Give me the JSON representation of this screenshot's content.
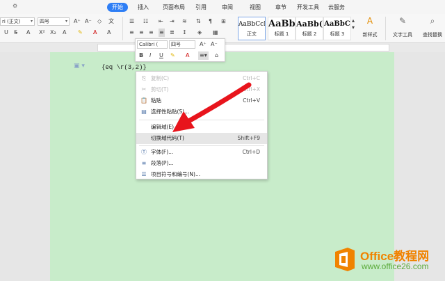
{
  "menu": {
    "tabs": [
      "开始",
      "插入",
      "页面布局",
      "引用",
      "审阅",
      "视图",
      "章节",
      "开发工具",
      "云服务"
    ],
    "active_index": 0
  },
  "ribbon": {
    "font_name": "ri (正文)",
    "font_size": "四号",
    "grow_font": "A⁺",
    "shrink_font": "A⁻",
    "font_color_label": "A",
    "styles": [
      {
        "sample": "AaBbCcI",
        "caption": "正文"
      },
      {
        "sample": "AaBb",
        "caption": "标题 1"
      },
      {
        "sample": "AaBb(",
        "caption": "标题 2"
      },
      {
        "sample": "AaBbC",
        "caption": "标题 3"
      }
    ],
    "new_style": "新样式",
    "text_tools": "文字工具",
    "find_replace": "查找替换"
  },
  "mini_toolbar": {
    "font_name": "Calibri (",
    "font_size": "四号",
    "bold": "B",
    "italic": "I",
    "underline": "U",
    "font_color": "A"
  },
  "document": {
    "field_code": "{eq \\r(3,2)}"
  },
  "context_menu": {
    "items": [
      {
        "label": "复制(C)",
        "shortcut": "Ctrl+C",
        "icon": "copy-icon",
        "glyph": "⎘",
        "disabled": true
      },
      {
        "label": "剪切(T)",
        "shortcut": "Ctrl+X",
        "icon": "cut-icon",
        "glyph": "✂",
        "disabled": true
      },
      {
        "label": "粘贴",
        "shortcut": "Ctrl+V",
        "icon": "paste-icon",
        "glyph": "📋",
        "disabled": false
      },
      {
        "label": "选择性粘贴(S)...",
        "shortcut": "",
        "icon": "paste-special-icon",
        "glyph": "▤",
        "disabled": false
      },
      {
        "label": "编辑域(E)...",
        "shortcut": "",
        "icon": "",
        "glyph": "",
        "disabled": false
      },
      {
        "label": "切换域代码(T)",
        "shortcut": "Shift+F9",
        "icon": "",
        "glyph": "",
        "disabled": false,
        "highlighted": true
      },
      {
        "label": "字体(F)...",
        "shortcut": "Ctrl+D",
        "icon": "font-icon",
        "glyph": "Ⓣ",
        "disabled": false
      },
      {
        "label": "段落(P)...",
        "shortcut": "",
        "icon": "paragraph-icon",
        "glyph": "≡",
        "disabled": false
      },
      {
        "label": "项目符号和编号(N)...",
        "shortcut": "",
        "icon": "bullets-icon",
        "glyph": "☰",
        "disabled": false
      }
    ]
  },
  "watermark": {
    "title": "Office教程网",
    "url": "www.office26.com"
  },
  "colors": {
    "accent": "#2e7ef5",
    "page_bg": "#c8ecca",
    "arrow": "#e8141c",
    "logo": "#f08300"
  }
}
